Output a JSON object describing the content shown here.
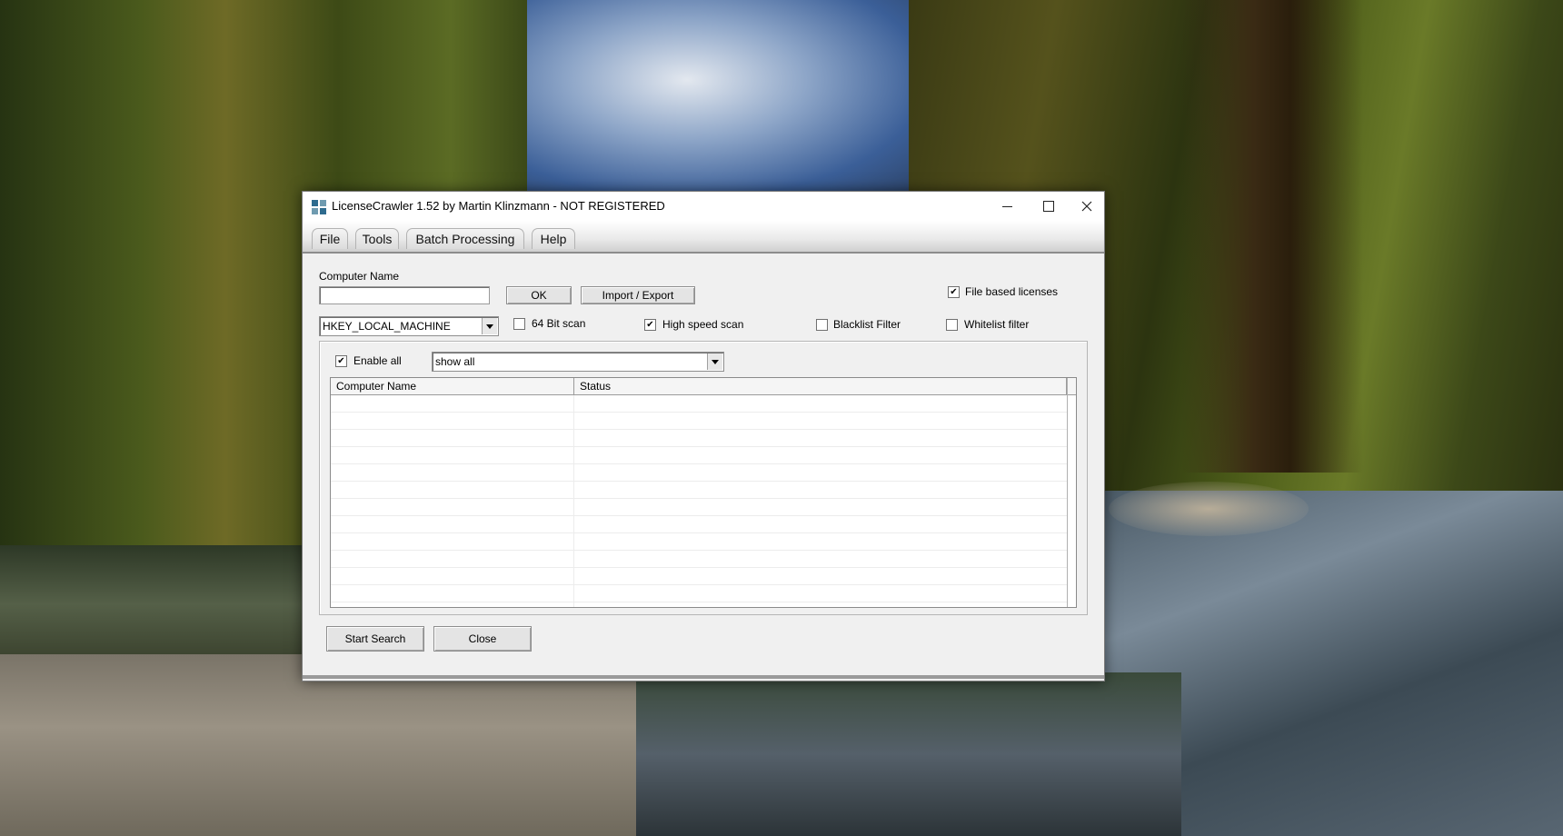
{
  "window": {
    "title": "LicenseCrawler 1.52 by Martin Klinzmann - NOT REGISTERED"
  },
  "menu": {
    "items": [
      {
        "label": "File"
      },
      {
        "label": "Tools"
      },
      {
        "label": "Batch Processing"
      },
      {
        "label": "Help"
      }
    ]
  },
  "form": {
    "computer_name_label": "Computer Name",
    "computer_name_value": "",
    "ok_label": "OK",
    "import_export_label": "Import / Export",
    "hive_selected": "HKEY_LOCAL_MACHINE",
    "options": {
      "file_based_licenses": {
        "label": "File based licenses",
        "checked": true
      },
      "bit64_scan": {
        "label": "64 Bit scan",
        "checked": false
      },
      "high_speed_scan": {
        "label": "High speed scan",
        "checked": true
      },
      "blacklist_filter": {
        "label": "Blacklist Filter",
        "checked": false
      },
      "whitelist_filter": {
        "label": "Whitelist filter",
        "checked": false
      }
    }
  },
  "batch": {
    "enable_all": {
      "label": "Enable all",
      "checked": true
    },
    "filter_selected": "show all",
    "columns": [
      "Computer Name",
      "Status"
    ]
  },
  "actions": {
    "start_search_label": "Start Search",
    "close_label": "Close"
  },
  "icons": {
    "app": "license-crawler-app-icon",
    "minimize": "minimize-icon",
    "maximize": "maximize-icon",
    "close": "close-icon",
    "dropdown": "chevron-down-icon",
    "check": "checkmark-icon"
  }
}
